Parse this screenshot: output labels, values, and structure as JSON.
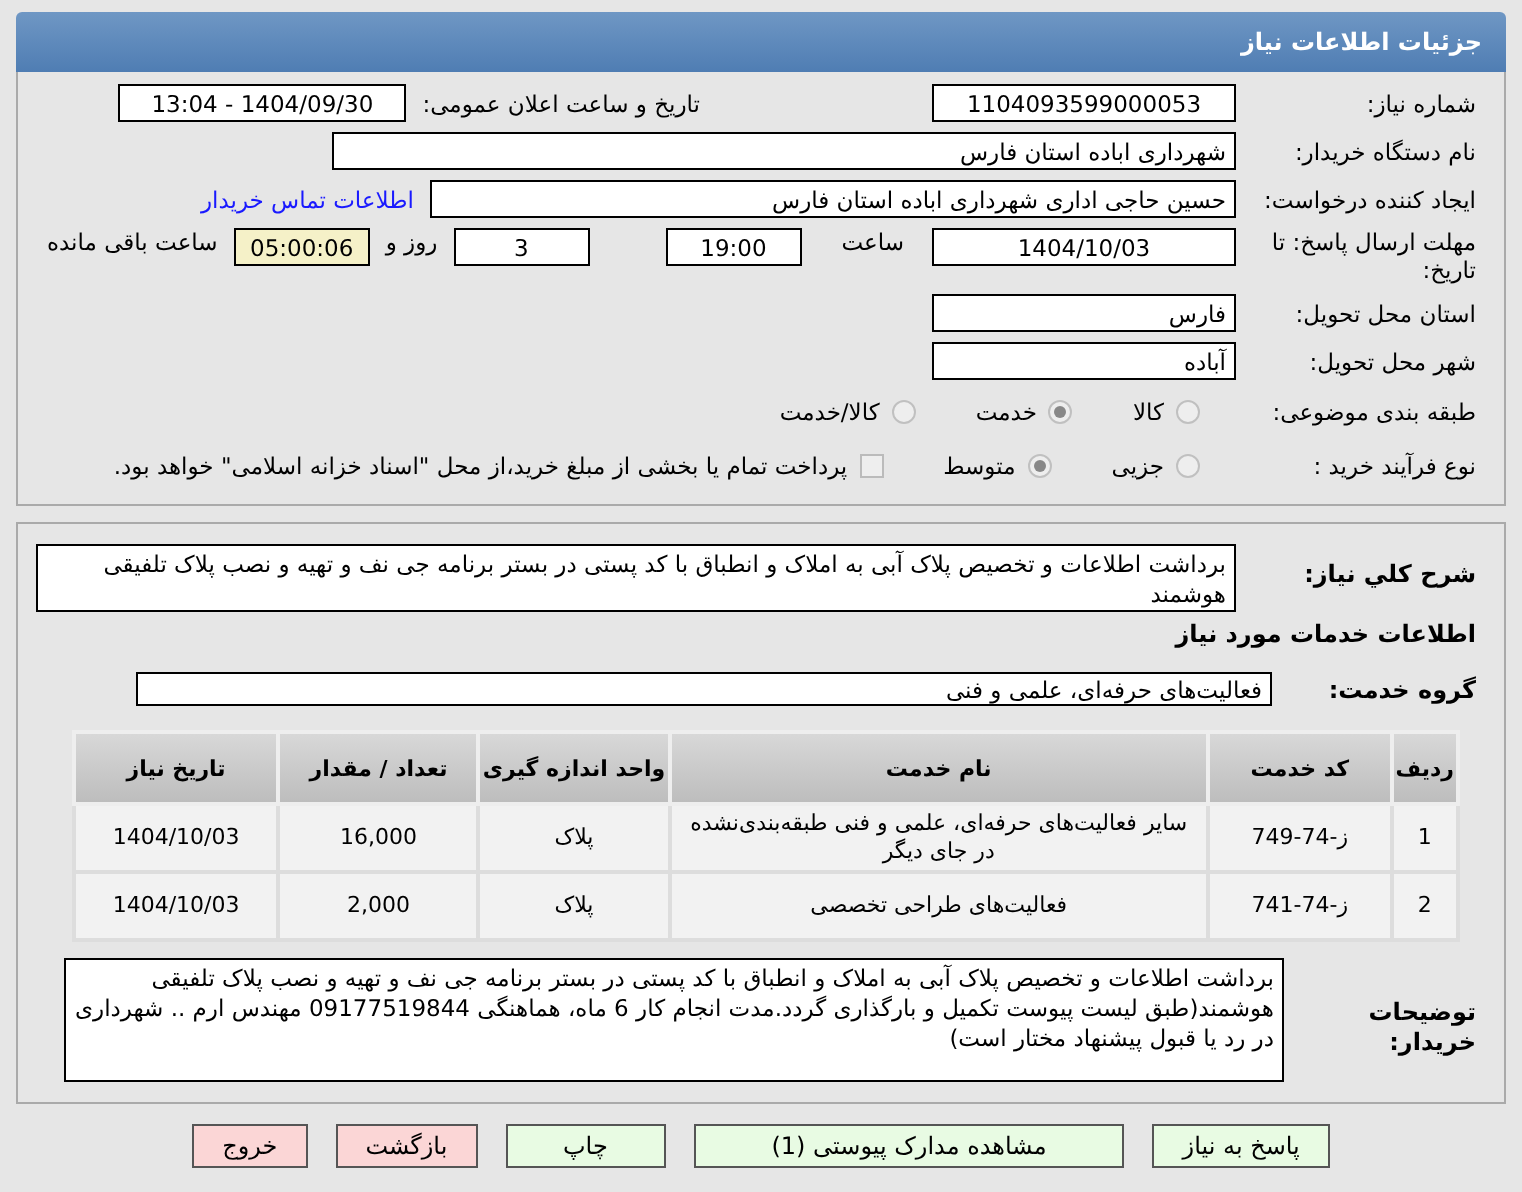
{
  "header": {
    "title": "جزئیات اطلاعات نیاز"
  },
  "need_number": {
    "label": "شماره نیاز:",
    "value": "1104093599000053"
  },
  "announce": {
    "label": "تاریخ و ساعت اعلان عمومی:",
    "value": "1404/09/30 - 13:04"
  },
  "buyer": {
    "label": "نام دستگاه خریدار:",
    "value": "شهرداری اباده استان فارس"
  },
  "requester": {
    "label": "ایجاد کننده درخواست:",
    "value": "حسین حاجی اداری شهرداری اباده استان فارس",
    "link": "اطلاعات تماس خریدار"
  },
  "deadline": {
    "label": "مهلت ارسال پاسخ: تا تاریخ:",
    "date": "1404/10/03",
    "time_label": "ساعت",
    "time": "19:00",
    "days": "3",
    "days_label": "روز و",
    "remaining": "05:00:06",
    "remaining_label": "ساعت باقی مانده"
  },
  "province": {
    "label": "استان محل تحویل:",
    "value": "فارس"
  },
  "city": {
    "label": "شهر محل تحویل:",
    "value": "آباده"
  },
  "category": {
    "label": "طبقه بندی موضوعی:",
    "options": [
      {
        "label": "کالا",
        "selected": false
      },
      {
        "label": "خدمت",
        "selected": true
      },
      {
        "label": "کالا/خدمت",
        "selected": false
      }
    ]
  },
  "process": {
    "label": "نوع فرآیند خرید :",
    "options": [
      {
        "label": "جزیی",
        "selected": false
      },
      {
        "label": "متوسط",
        "selected": true
      }
    ],
    "payment": {
      "checked": false,
      "label": "پرداخت تمام یا بخشی از مبلغ خرید،از محل \"اسناد خزانه اسلامی\" خواهد بود."
    }
  },
  "summary": {
    "label": "شرح کلي نياز:",
    "value": "برداشت اطلاعات و تخصیص پلاک آبی به املاک و انطباق با کد پستی در بستر برنامه جی نف و تهیه و نصب پلاک تلفیقی هوشمند"
  },
  "services_title": "اطلاعات خدمات مورد نیاز",
  "service_group": {
    "label": "گروه خدمت:",
    "value": "فعالیت‌های حرفه‌ای، علمی و فنی"
  },
  "table": {
    "columns": [
      "ردیف",
      "کد خدمت",
      "نام خدمت",
      "واحد اندازه گیری",
      "تعداد / مقدار",
      "تاریخ نیاز"
    ],
    "rows": [
      [
        "1",
        "ز-74-749",
        "سایر فعالیت‌های حرفه‌ای، علمی و فنی طبقه‌بندی‌نشده در جای دیگر",
        "پلاک",
        "16,000",
        "1404/10/03"
      ],
      [
        "2",
        "ز-74-741",
        "فعالیت‌های طراحی تخصصی",
        "پلاک",
        "2,000",
        "1404/10/03"
      ]
    ]
  },
  "buyer_notes": {
    "label": "توضیحات خریدار:",
    "value": "برداشت اطلاعات و تخصیص پلاک آبی به املاک و انطباق با کد پستی در بستر برنامه جی نف و تهیه و نصب پلاک تلفیقی هوشمند(طبق لیست پیوست تکمیل و بارگذاری گردد.مدت انجام کار 6 ماه، هماهنگی 09177519844 مهندس ارم .. شهرداری در رد یا قبول پیشنهاد مختار است)"
  },
  "buttons": [
    {
      "label": "پاسخ به نیاز",
      "kind": "action"
    },
    {
      "label": "مشاهده مدارک پیوستی (1)",
      "kind": "action"
    },
    {
      "label": "چاپ",
      "kind": "action"
    },
    {
      "label": "بازگشت",
      "kind": "danger"
    },
    {
      "label": "خروج",
      "kind": "danger"
    }
  ]
}
